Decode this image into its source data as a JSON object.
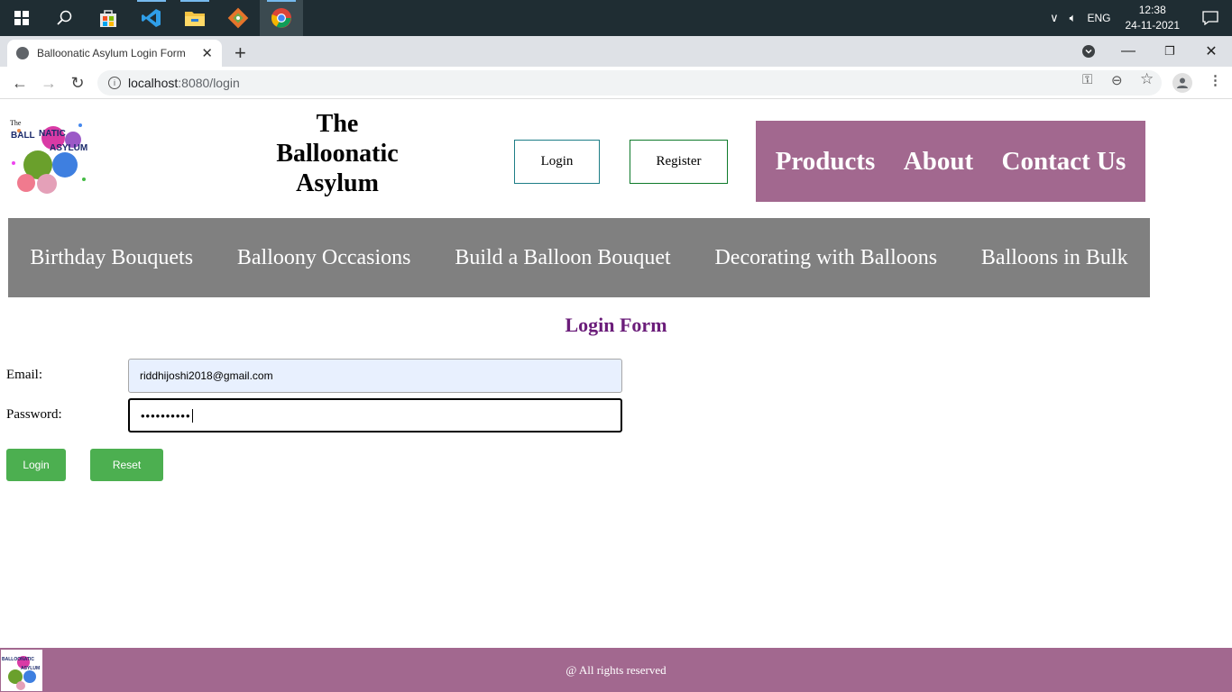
{
  "taskbar": {
    "language": "ENG",
    "time": "12:38",
    "date": "24-11-2021"
  },
  "browser": {
    "tab_title": "Balloonatic Asylum Login Form",
    "url_host": "localhost",
    "url_rest": ":8080/login"
  },
  "header": {
    "logo_text": "The BALLOONATIC ASYLUM",
    "brand_line1": "The",
    "brand_line2": "Balloonatic",
    "brand_line3": "Asylum",
    "login_label": "Login",
    "register_label": "Register",
    "nav": [
      "Products",
      "About",
      "Contact Us"
    ]
  },
  "categories": [
    "Birthday Bouquets",
    "Balloony Occasions",
    "Build a Balloon Bouquet",
    "Decorating with Balloons",
    "Balloons in Bulk"
  ],
  "form": {
    "title": "Login Form",
    "email_label": "Email:",
    "email_value": "riddhijoshi2018@gmail.com",
    "password_label": "Password:",
    "password_value": "••••••••••",
    "login_button": "Login",
    "reset_button": "Reset"
  },
  "footer": {
    "text": "@ All rights reserved"
  },
  "colors": {
    "purple_nav": "#a2688f",
    "grey_bar": "#808080",
    "form_title": "#6b1d7a",
    "green_button": "#4caf50"
  }
}
